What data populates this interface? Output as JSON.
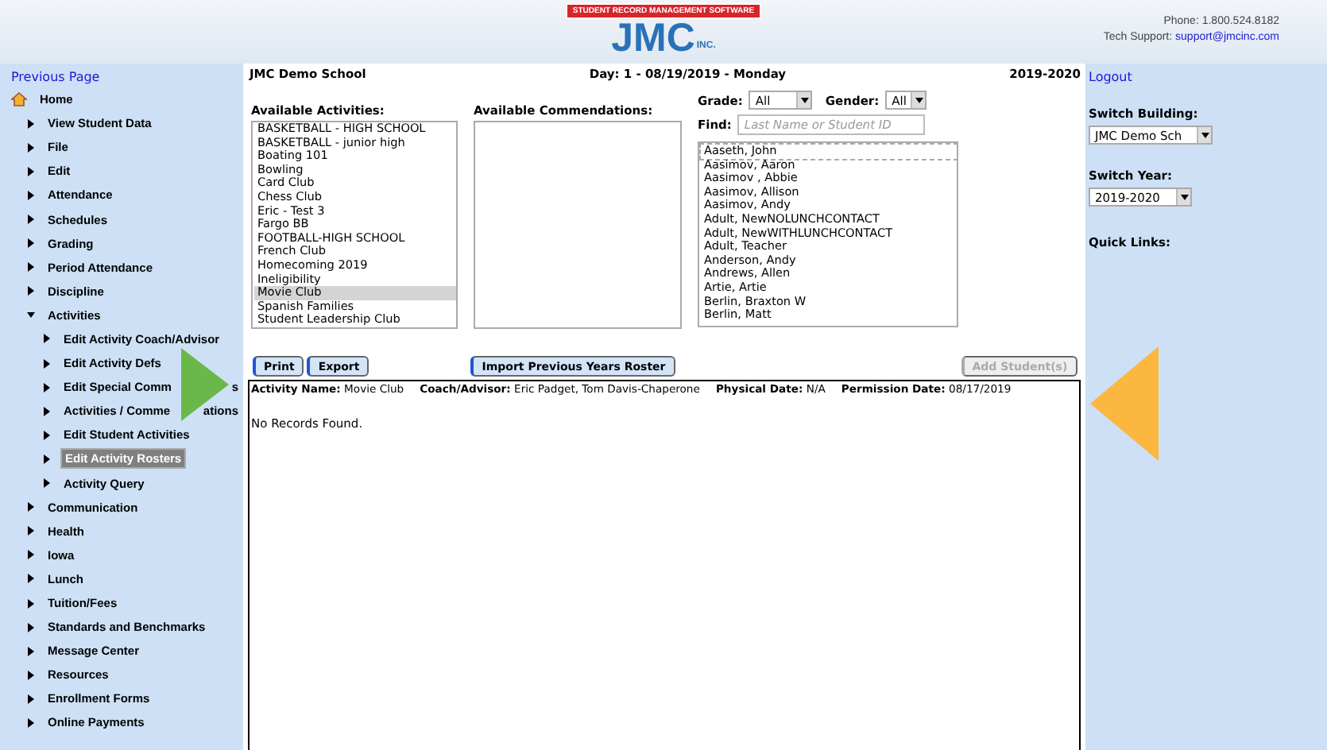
{
  "header": {
    "logo": {
      "brand": "JMC",
      "tagline": "STUDENT RECORD MANAGEMENT SOFTWARE",
      "suffix": "INC."
    },
    "phone": "Phone: 1.800.524.8182",
    "support_label": "Tech Support:",
    "support_email": "support@jmcinc.com"
  },
  "topbar": {
    "previous_page": "Previous Page",
    "school": "JMC Demo School",
    "day": "Day: 1 - 08/19/2019 - Monday",
    "year": "2019-2020",
    "logout": "Logout"
  },
  "sidebar": {
    "home": "Home",
    "items": [
      {
        "label": "View Student Data",
        "expanded": false
      },
      {
        "label": "File",
        "expanded": false
      },
      {
        "label": "Edit",
        "expanded": false
      },
      {
        "label": "Attendance",
        "expanded": false
      },
      {
        "label": "Schedules",
        "expanded": false
      },
      {
        "label": "Grading",
        "expanded": false
      },
      {
        "label": "Period Attendance",
        "expanded": false
      },
      {
        "label": "Discipline",
        "expanded": false
      },
      {
        "label": "Activities",
        "expanded": true,
        "children": [
          {
            "label": "Edit Activity Coach/Advisor",
            "selected": false
          },
          {
            "label": "Edit Activity Defs",
            "selected": false
          },
          {
            "label": "Edit Special Comm",
            "tail": "s",
            "selected": false
          },
          {
            "label": "Activities / Comme",
            "tail": "ations",
            "selected": false
          },
          {
            "label": "Edit Student Activities",
            "selected": false
          },
          {
            "label": "Edit Activity Rosters",
            "selected": true
          },
          {
            "label": "Activity Query",
            "selected": false
          }
        ]
      },
      {
        "label": "Communication",
        "expanded": false
      },
      {
        "label": "Health",
        "expanded": false
      },
      {
        "label": "Iowa",
        "expanded": false
      },
      {
        "label": "Lunch",
        "expanded": false
      },
      {
        "label": "Tuition/Fees",
        "expanded": false
      },
      {
        "label": "Standards and Benchmarks",
        "expanded": false
      },
      {
        "label": "Message Center",
        "expanded": false
      },
      {
        "label": "Resources",
        "expanded": false
      },
      {
        "label": "Enrollment Forms",
        "expanded": false
      },
      {
        "label": "Online Payments",
        "expanded": false
      }
    ]
  },
  "activities": {
    "label": "Available Activities:",
    "items": [
      {
        "label": "BASKETBALL - HIGH SCHOOL",
        "selected": false
      },
      {
        "label": "BASKETBALL - junior high",
        "selected": false
      },
      {
        "label": "Boating 101",
        "selected": false
      },
      {
        "label": "Bowling",
        "selected": false
      },
      {
        "label": "Card Club",
        "selected": false
      },
      {
        "label": "Chess Club",
        "selected": false
      },
      {
        "label": "Eric - Test 3",
        "selected": false
      },
      {
        "label": "Fargo BB",
        "selected": false
      },
      {
        "label": "FOOTBALL-HIGH SCHOOL",
        "selected": false
      },
      {
        "label": "French Club",
        "selected": false
      },
      {
        "label": "Homecoming 2019",
        "selected": false
      },
      {
        "label": "Ineligibility",
        "selected": false
      },
      {
        "label": "Movie Club",
        "selected": true
      },
      {
        "label": "Spanish Families",
        "selected": false
      },
      {
        "label": "Student Leadership Club",
        "selected": false
      }
    ]
  },
  "commendations": {
    "label": "Available Commendations:"
  },
  "filters": {
    "grade_label": "Grade:",
    "grade": "All",
    "gender_label": "Gender:",
    "gender": "All",
    "find_label": "Find:",
    "find_placeholder": "Last Name or Student ID"
  },
  "students": [
    {
      "label": "Aaseth, John",
      "focused": true
    },
    {
      "label": "Aasimov, Aaron",
      "focused": false
    },
    {
      "label": "Aasimov , Abbie",
      "focused": false
    },
    {
      "label": "Aasimov, Allison",
      "focused": false
    },
    {
      "label": "Aasimov, Andy",
      "focused": false
    },
    {
      "label": "Adult, NewNOLUNCHCONTACT",
      "focused": false
    },
    {
      "label": "Adult, NewWITHLUNCHCONTACT",
      "focused": false
    },
    {
      "label": "Adult, Teacher",
      "focused": false
    },
    {
      "label": "Anderson, Andy",
      "focused": false
    },
    {
      "label": "Andrews, Allen",
      "focused": false
    },
    {
      "label": "Artie, Artie",
      "focused": false
    },
    {
      "label": "Berlin, Braxton W",
      "focused": false
    },
    {
      "label": "Berlin, Matt",
      "focused": false
    }
  ],
  "buttons": [
    {
      "label": "Print",
      "disabled": false
    },
    {
      "label": "Export",
      "disabled": false
    },
    {
      "label": "Import Previous Years Roster",
      "disabled": false
    },
    {
      "label": "Add Student(s)",
      "disabled": true
    }
  ],
  "roster": {
    "fields": [
      {
        "label": "Activity Name:",
        "value": "Movie Club"
      },
      {
        "label": "Coach/Advisor:",
        "value": "Eric Padget, Tom Davis-Chaperone"
      },
      {
        "label": "Physical Date:",
        "value": "N/A"
      },
      {
        "label": "Permission Date:",
        "value": "08/17/2019"
      }
    ],
    "empty_message": "No Records Found."
  },
  "right_panel": {
    "building_label": "Switch Building:",
    "building": "JMC Demo Sch",
    "year_label": "Switch Year:",
    "year": "2019-2020",
    "quick_links": "Quick Links:"
  }
}
